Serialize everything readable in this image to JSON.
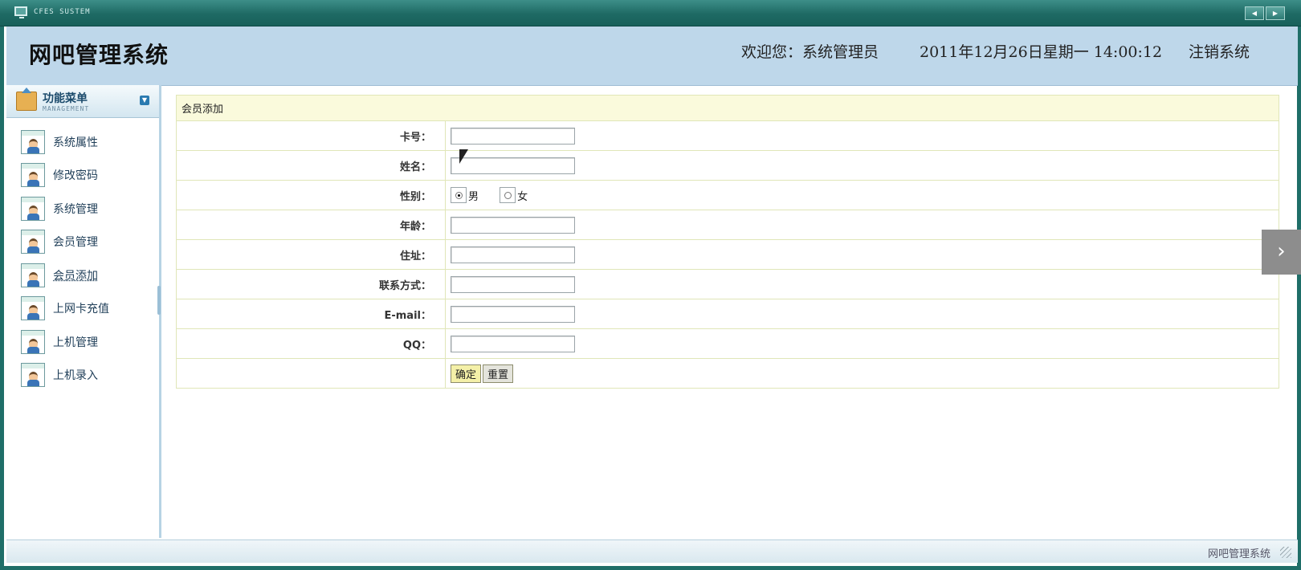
{
  "window": {
    "title": "CFES SUSTEM"
  },
  "header": {
    "system_title": "网吧管理系统",
    "welcome": "欢迎您：系统管理员",
    "datetime": "2011年12月26日星期一  14:00:12",
    "logout": "注销系统"
  },
  "sidebar": {
    "menu_title": "功能菜单",
    "menu_subtitle": "MANAGEMENT",
    "items": [
      {
        "label": "系统属性"
      },
      {
        "label": "修改密码"
      },
      {
        "label": "系统管理"
      },
      {
        "label": "会员管理"
      },
      {
        "label": "会员添加"
      },
      {
        "label": "上网卡充值"
      },
      {
        "label": "上机管理"
      },
      {
        "label": "上机录入"
      }
    ]
  },
  "form": {
    "caption": "会员添加",
    "fields": {
      "card": {
        "label": "卡号：",
        "value": ""
      },
      "name": {
        "label": "姓名：",
        "value": ""
      },
      "gender": {
        "label": "性别：",
        "male": "男",
        "female": "女",
        "selected": "男"
      },
      "age": {
        "label": "年龄：",
        "value": ""
      },
      "address": {
        "label": "住址：",
        "value": ""
      },
      "contact": {
        "label": "联系方式：",
        "value": ""
      },
      "email": {
        "label": "E-mail：",
        "value": ""
      },
      "qq": {
        "label": "QQ：",
        "value": ""
      }
    },
    "buttons": {
      "confirm": "确定",
      "reset": "重置"
    }
  },
  "footer": {
    "text": "网吧管理系统"
  },
  "colors": {
    "titlebar": "#1e6a64",
    "header_bg": "#bed7ea",
    "caption_bg": "#fafadc",
    "confirm_bg": "#f4f0a8"
  }
}
